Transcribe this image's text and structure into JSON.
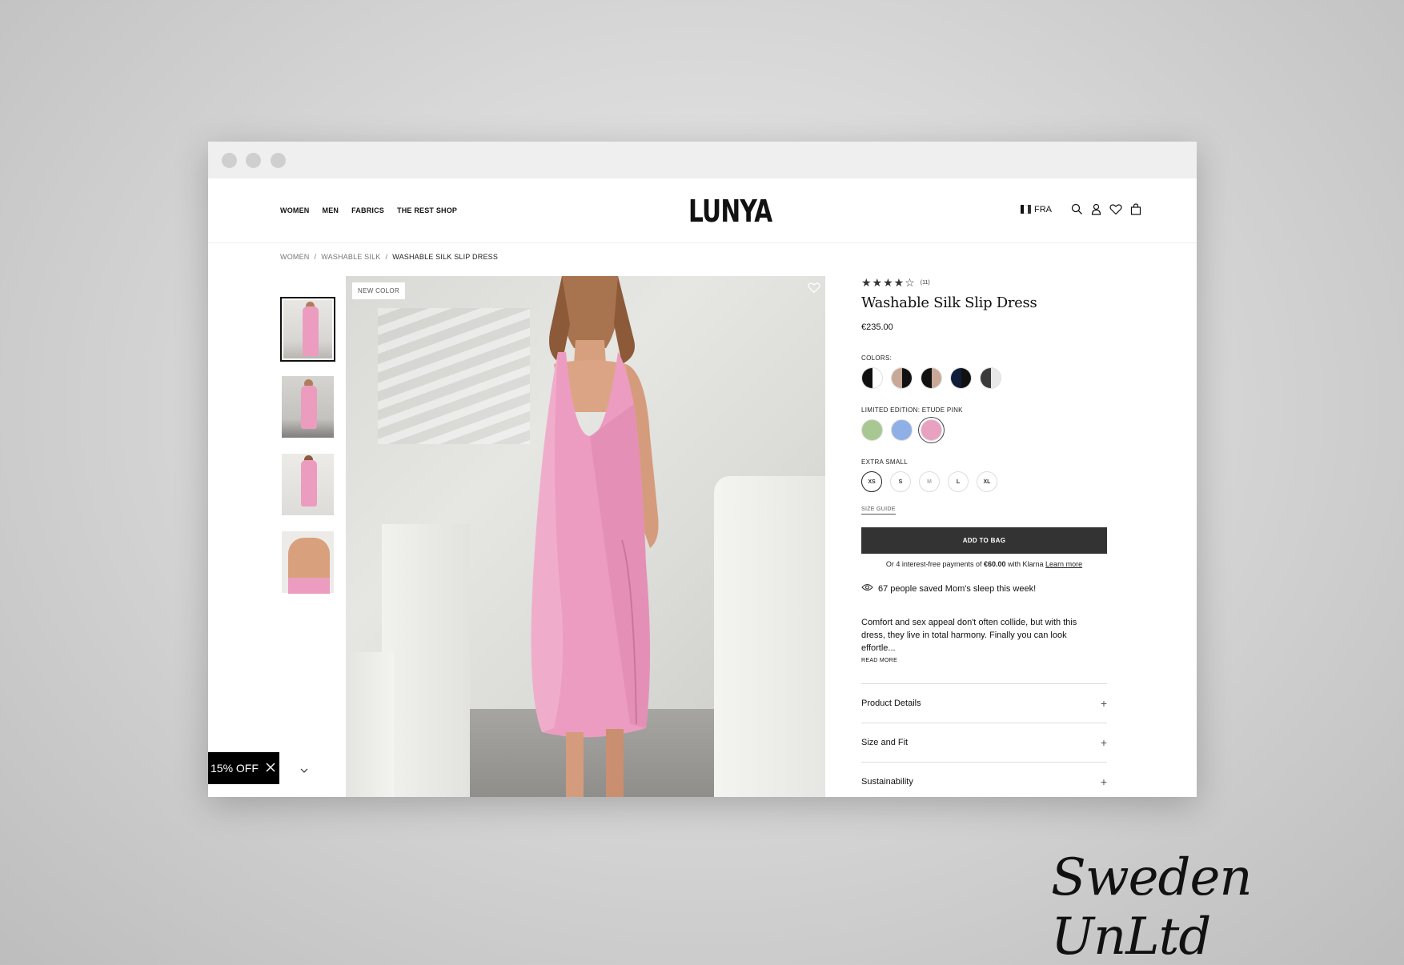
{
  "window": {
    "dots": [
      "",
      "",
      ""
    ]
  },
  "header": {
    "nav": [
      "WOMEN",
      "MEN",
      "FABRICS",
      "THE REST SHOP"
    ],
    "logo": "LUNYA",
    "region": "FRA",
    "icons": [
      "search-icon",
      "account-icon",
      "wishlist-icon",
      "bag-icon"
    ]
  },
  "breadcrumb": {
    "items": [
      "WOMEN",
      "WASHABLE SILK",
      "WASHABLE SILK SLIP DRESS"
    ],
    "separator": "/"
  },
  "gallery": {
    "thumbnails": 4,
    "badge": "NEW COLOR"
  },
  "promo": {
    "label": "15% OFF"
  },
  "product": {
    "rating": 4.5,
    "stars": "★★★★☆",
    "review_count": "(11)",
    "title": "Washable Silk Slip Dress",
    "price": "€235.00",
    "colors_label": "COLORS:",
    "colors": [
      {
        "left": "#111111",
        "right": "#ffffff"
      },
      {
        "left": "#c8a896",
        "right": "#111111"
      },
      {
        "left": "#111111",
        "right": "#c8a896"
      },
      {
        "left": "#0f1d3a",
        "right": "#111111"
      },
      {
        "left": "#3a3a3a",
        "right": "#e8e8e8"
      }
    ],
    "limited_label": "LIMITED EDITION: ETUDE PINK",
    "limited_colors": [
      "#a9c792",
      "#8fb0e6",
      "#e9a1c2"
    ],
    "size_label": "EXTRA SMALL",
    "sizes": [
      "XS",
      "S",
      "M",
      "L",
      "XL"
    ],
    "size_guide": "SIZE GUIDE",
    "add_to_bag": "ADD TO BAG",
    "klarna_pre": "Or 4 interest-free payments of ",
    "klarna_amount": "€60.00",
    "klarna_mid": " with Klarna ",
    "klarna_link": "Learn more",
    "saved_text": "67 people saved Mom's sleep this week!",
    "description": "Comfort and sex appeal don't often collide, but with this dress, they live in total harmony. Finally you can look effortle...",
    "read_more": "READ MORE",
    "accordion": [
      "Product Details",
      "Size and Fit",
      "Sustainability"
    ],
    "accordion_icon": "+"
  },
  "watermark": "Sweden UnLtd"
}
